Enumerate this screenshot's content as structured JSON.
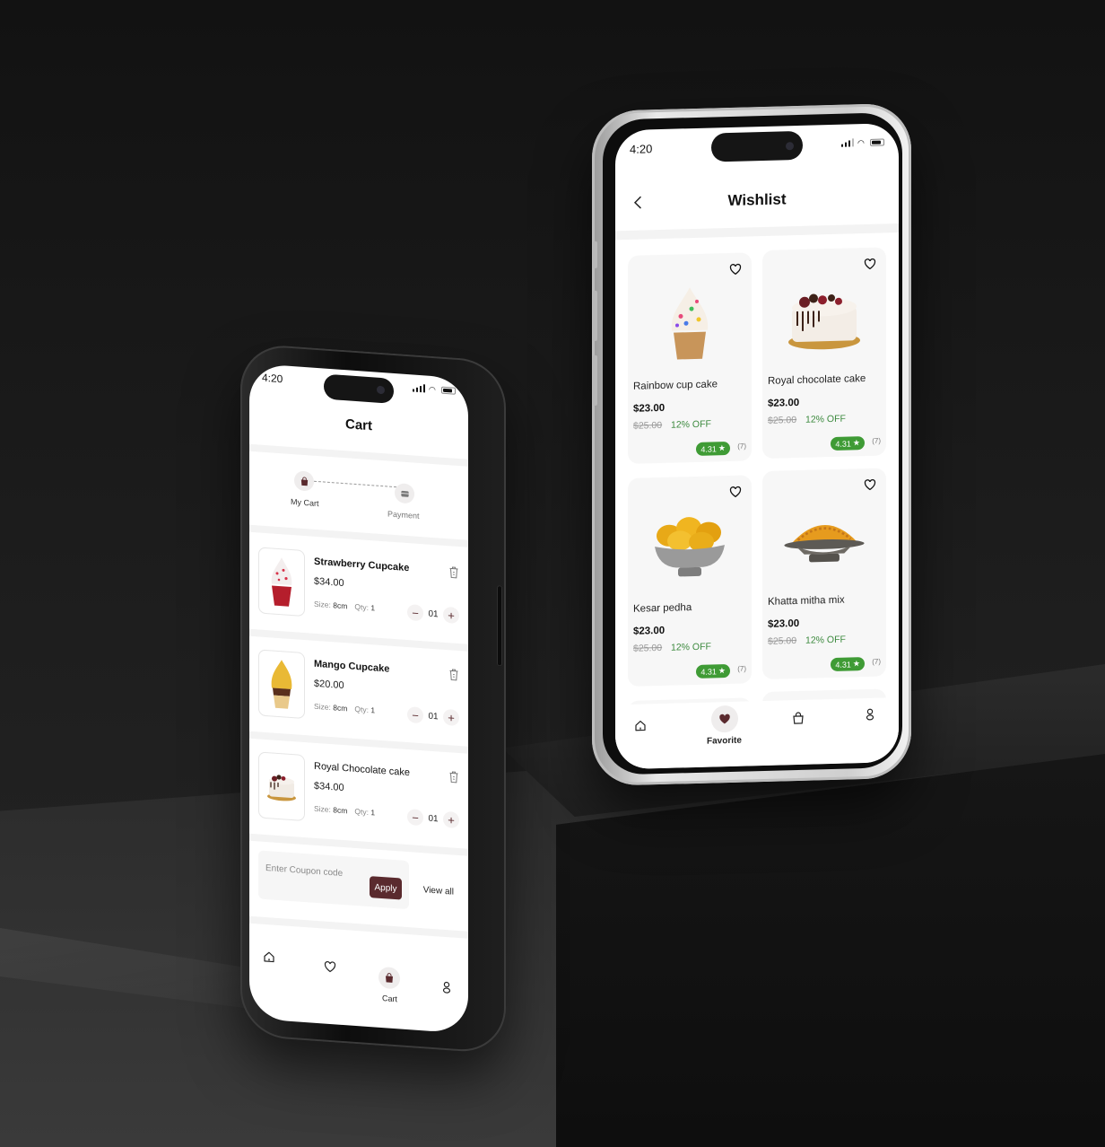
{
  "status_bar": {
    "time": "4:20"
  },
  "cart_screen": {
    "title": "Cart",
    "steps": [
      {
        "label": "My Cart",
        "icon": "shopping-bag-icon",
        "active": true
      },
      {
        "label": "Payment",
        "icon": "card-icon",
        "active": false
      }
    ],
    "items": [
      {
        "name": "Strawberry Cupcake",
        "price": "$34.00",
        "size_label": "Size:",
        "size": "8cm",
        "qty_label": "Qty:",
        "qty": "1",
        "stepper_value": "01",
        "image": "strawberry-cupcake"
      },
      {
        "name": "Mango Cupcake",
        "price": "$20.00",
        "size_label": "Size:",
        "size": "8cm",
        "qty_label": "Qty:",
        "qty": "1",
        "stepper_value": "01",
        "image": "mango-cupcake"
      },
      {
        "name": "Royal Chocolate cake",
        "price": "$34.00",
        "size_label": "Size:",
        "size": "8cm",
        "qty_label": "Qty:",
        "qty": "1",
        "stepper_value": "01",
        "image": "royal-chocolate-cake"
      }
    ],
    "stepper": {
      "minus": "−",
      "plus": "+"
    },
    "coupon": {
      "placeholder": "Enter Coupon code",
      "apply_label": "Apply",
      "view_all_label": "View all"
    },
    "nav": {
      "items": [
        {
          "icon": "home-icon",
          "active": false
        },
        {
          "icon": "heart-icon",
          "active": false
        },
        {
          "icon": "shopping-bag-icon",
          "label": "Cart",
          "active": true
        },
        {
          "icon": "profile-icon",
          "active": false
        }
      ]
    }
  },
  "wishlist_screen": {
    "title": "Wishlist",
    "products": [
      {
        "name": "Rainbow cup cake",
        "price": "$23.00",
        "old_price": "$25.00",
        "discount": "12% OFF",
        "rating": "4.31",
        "reviews": "(7)",
        "image": "rainbow-cupcake"
      },
      {
        "name": "Royal chocolate cake",
        "price": "$23.00",
        "old_price": "$25.00",
        "discount": "12% OFF",
        "rating": "4.31",
        "reviews": "(7)",
        "image": "royal-chocolate-cake"
      },
      {
        "name": "Kesar pedha",
        "price": "$23.00",
        "old_price": "$25.00",
        "discount": "12% OFF",
        "rating": "4.31",
        "reviews": "(7)",
        "image": "kesar-pedha"
      },
      {
        "name": "Khatta mitha mix",
        "price": "$23.00",
        "old_price": "$25.00",
        "discount": "12% OFF",
        "rating": "4.31",
        "reviews": "(7)",
        "image": "khatta-mitha-mix"
      }
    ],
    "nav": {
      "items": [
        {
          "icon": "home-icon",
          "active": false
        },
        {
          "icon": "heart-icon",
          "label": "Favorite",
          "active": true
        },
        {
          "icon": "shopping-bag-icon",
          "active": false
        },
        {
          "icon": "profile-icon",
          "active": false
        }
      ]
    }
  },
  "colors": {
    "accent": "#5a2a2e",
    "rating_green": "#3f9b35",
    "discount_green": "#3c8a3e",
    "background": "#1b1b1b"
  }
}
